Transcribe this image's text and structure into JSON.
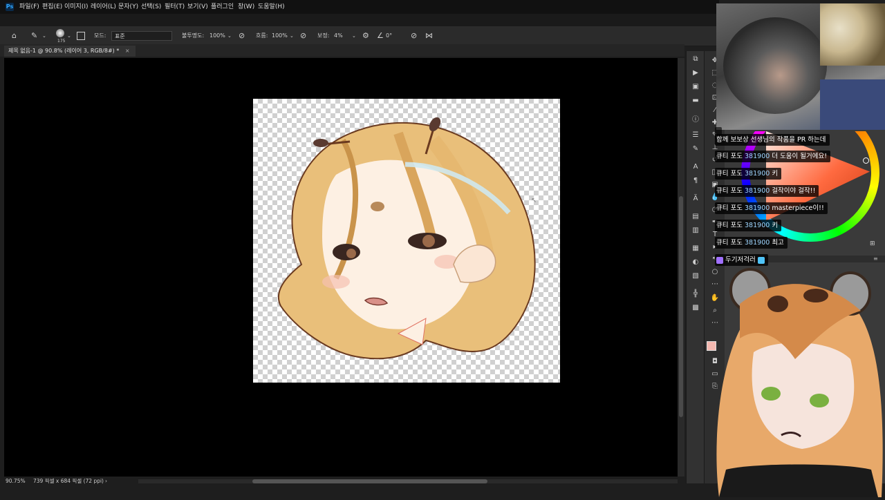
{
  "menu": [
    "파일(F)",
    "편집(E)",
    "이미지(I)",
    "레이어(L)",
    "문자(Y)",
    "선택(S)",
    "필터(T)",
    "보기(V)",
    "플러그인",
    "창(W)",
    "도움말(H)"
  ],
  "options": {
    "brush_size": "175",
    "mode_label": "모드:",
    "mode_value": "표준",
    "opacity_label": "불투명도:",
    "opacity_value": "100%",
    "flow_label": "흐름:",
    "flow_value": "100%",
    "smoothing_label": "보정:",
    "smoothing_value": "4%",
    "angle_value": "0°"
  },
  "document_tab": {
    "title": "제목 없음-1 @ 90.8% (레이어 3, RGB/8#) *",
    "close": "×"
  },
  "status": {
    "zoom": "90.75%",
    "dimensions": "739 픽셀 x 684 픽셀 (72 ppi)",
    "arrow": "›"
  },
  "chat": {
    "partial_lines": [
      "함께 보보상 선생님의 작품을 PR 하는데"
    ],
    "messages": [
      {
        "user": "큐티 포도",
        "id": "381900",
        "text": "더 도움이 될거에요!"
      },
      {
        "user": "큐티 포도",
        "id": "381900",
        "text": "키"
      },
      {
        "user": "큐티 포도",
        "id": "381900",
        "text": "걸작이야 걸작!!"
      },
      {
        "user": "큐티 포도",
        "id": "381900",
        "text": "masterpiece이!!"
      },
      {
        "user": "큐티 포도",
        "id": "381900",
        "text": "키"
      },
      {
        "user": "큐티 포도",
        "id": "381900",
        "text": "최고"
      }
    ],
    "viewer_name": "두기저걱러"
  },
  "colors": {
    "foreground": "#f4b8b0",
    "background": "#ffffff",
    "accent": "#31a8ff"
  }
}
